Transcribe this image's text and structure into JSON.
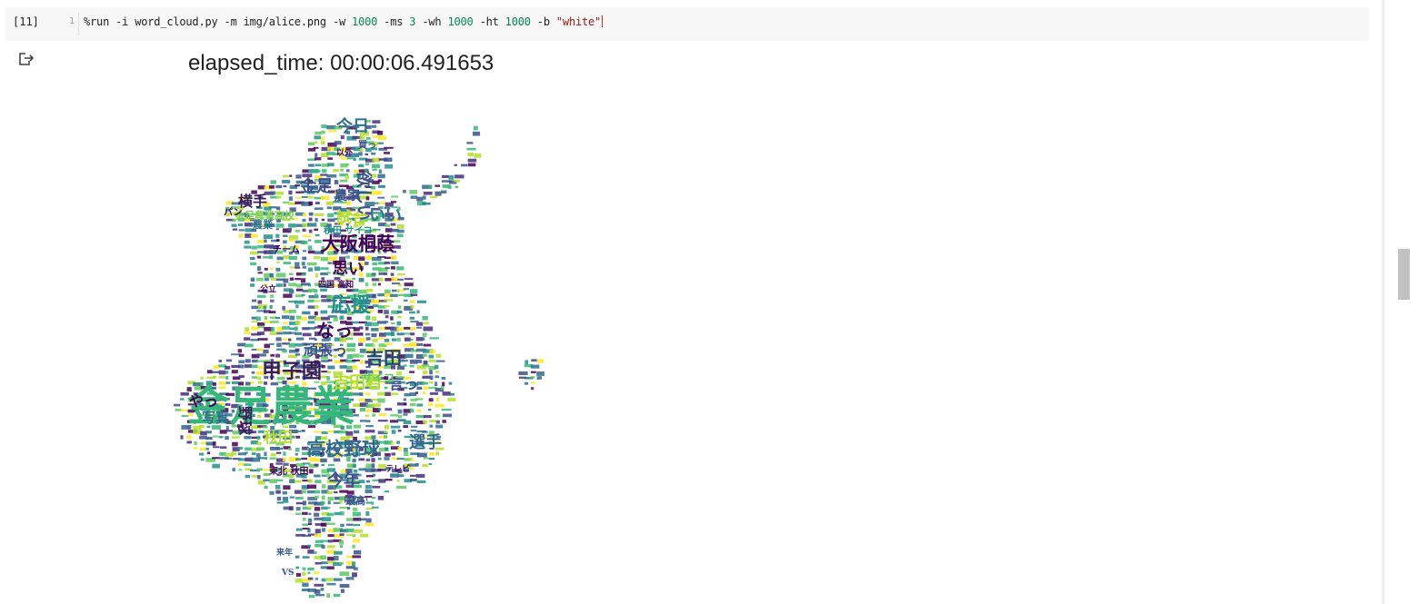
{
  "cell": {
    "execution_count": "[11]",
    "line_number": "1",
    "code": {
      "p1": "%run -i word_cloud.py -m img/alice.png -w ",
      "n1": "1000",
      "p2": " -ms ",
      "n2": "3",
      "p3": " -wh ",
      "n3": "1000",
      "p4": " -ht ",
      "n4": "1000",
      "p5": " -b ",
      "s1": "\"white\""
    }
  },
  "output": {
    "icon": "output-redirect-icon",
    "elapsed_time": "elapsed_time: 00:00:06.491653"
  },
  "wordcloud": {
    "image": "alice silhouette word cloud",
    "words": [
      {
        "text": "金足農業",
        "color": "#35b779"
      },
      {
        "text": "甲子園",
        "color": "#3b1c5a"
      },
      {
        "text": "高校野球",
        "color": "#31688e"
      },
      {
        "text": "吉田君",
        "color": "#b5de2b"
      },
      {
        "text": "吉田",
        "color": "#26466d"
      },
      {
        "text": "応援",
        "color": "#21918c"
      },
      {
        "text": "大阪桐蔭",
        "color": "#440154"
      },
      {
        "text": "金足",
        "color": "#3a528b"
      },
      {
        "text": "今日",
        "color": "#2c728e"
      },
      {
        "text": "試合",
        "color": "#b5de2b"
      },
      {
        "text": "いい",
        "color": "#2c728e"
      },
      {
        "text": "横手",
        "color": "#3b1c5a"
      },
      {
        "text": "なっ",
        "color": "#440154"
      },
      {
        "text": "思い",
        "color": "#440154"
      },
      {
        "text": "頑張っ",
        "color": "#3b528b"
      },
      {
        "text": "選手",
        "color": "#31688e"
      },
      {
        "text": "今年",
        "color": "#3b528b"
      },
      {
        "text": "秋田",
        "color": "#b5de2b"
      },
      {
        "text": "野球",
        "color": "#3b1c5a"
      },
      {
        "text": "写真",
        "color": "#31688e"
      },
      {
        "text": "やっ",
        "color": "#440154"
      },
      {
        "text": "言っ",
        "color": "#3b528b"
      },
      {
        "text": "サイコー",
        "color": "#5ec962"
      },
      {
        "text": "東北 秋田",
        "color": "#440154"
      },
      {
        "text": "四国 高知",
        "color": "#440154"
      },
      {
        "text": "農家",
        "color": "#3b528b"
      },
      {
        "text": "金足農業高校",
        "color": "#7ad151"
      },
      {
        "text": "秋田 サイコー",
        "color": "#21918c"
      },
      {
        "text": "チーム",
        "color": "#440154"
      },
      {
        "text": "農業",
        "color": "#2c728e"
      },
      {
        "text": "ほしい",
        "color": "#3b528b"
      },
      {
        "text": "最高",
        "color": "#3b528b"
      },
      {
        "text": "テレビ",
        "color": "#440154"
      },
      {
        "text": "VS",
        "color": "#3b528b"
      },
      {
        "text": "欲しい",
        "color": "#3b528b"
      },
      {
        "text": "来年",
        "color": "#3b528b"
      },
      {
        "text": "公立",
        "color": "#440154"
      },
      {
        "text": "以外",
        "color": "#440154"
      },
      {
        "text": "買っ",
        "color": "#3b528b"
      },
      {
        "text": "パン",
        "color": "#440154"
      }
    ]
  }
}
